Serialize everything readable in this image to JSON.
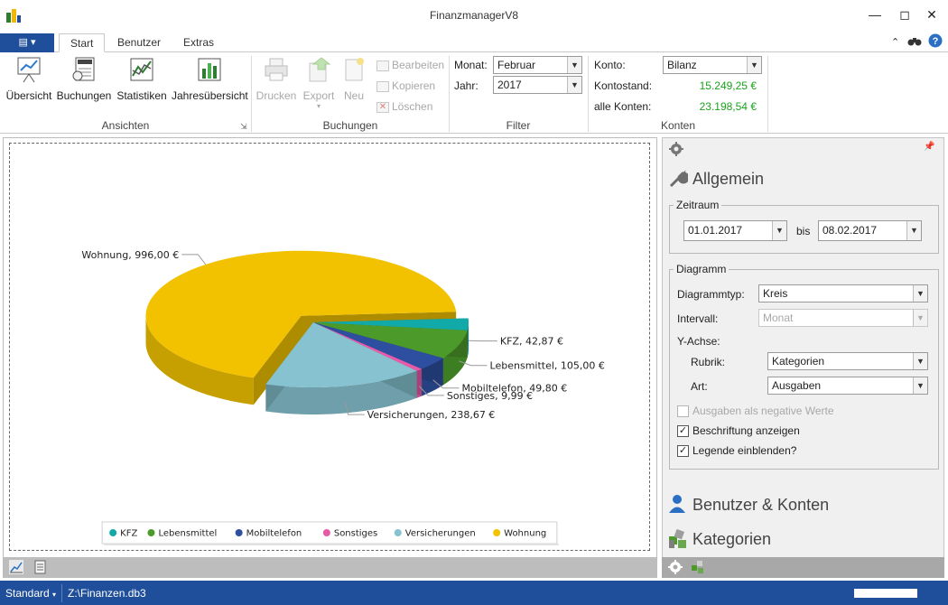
{
  "window": {
    "title": "FinanzmanagerV8"
  },
  "tabs": [
    {
      "label": "Start"
    },
    {
      "label": "Benutzer"
    },
    {
      "label": "Extras"
    }
  ],
  "ribbon": {
    "ansichten": {
      "label": "Ansichten",
      "buttons": [
        {
          "label": "Übersicht",
          "icon": "overview-icon"
        },
        {
          "label": "Buchungen",
          "icon": "invoice-icon"
        },
        {
          "label": "Statistiken",
          "icon": "statistics-icon"
        },
        {
          "label": "Jahresübersicht",
          "icon": "year-overview-icon"
        }
      ]
    },
    "buchungen": {
      "label": "Buchungen",
      "buttons": [
        {
          "label": "Drucken"
        },
        {
          "label": "Export"
        },
        {
          "label": "Neu"
        }
      ],
      "small": [
        {
          "label": "Bearbeiten"
        },
        {
          "label": "Kopieren"
        },
        {
          "label": "Löschen"
        }
      ]
    },
    "filter": {
      "label": "Filter",
      "monat_label": "Monat:",
      "monat_value": "Februar",
      "jahr_label": "Jahr:",
      "jahr_value": "2017"
    },
    "konten": {
      "label": "Konten",
      "konto_label": "Konto:",
      "konto_value": "Bilanz",
      "kontostand_label": "Kontostand:",
      "kontostand_value": "15.249,25 €",
      "alle_label": "alle Konten:",
      "alle_value": "23.198,54 €"
    }
  },
  "chart_data": {
    "type": "pie",
    "style": "3d-exploded",
    "categories": [
      "KFZ",
      "Lebensmittel",
      "Mobiltelefon",
      "Sonstiges",
      "Versicherungen",
      "Wohnung"
    ],
    "values": [
      42.87,
      105.0,
      49.8,
      9.99,
      238.67,
      996.0
    ],
    "colors": [
      "#12aaa8",
      "#4c9a2a",
      "#2e4f9f",
      "#e85aa8",
      "#86c2d0",
      "#f2c200"
    ],
    "data_labels": [
      "KFZ, 42,87 €",
      "Lebensmittel, 105,00 €",
      "Mobiltelefon, 49,80 €",
      "Sonstiges, 9,99 €",
      "Versicherungen, 238,67 €",
      "Wohnung, 996,00 €"
    ],
    "legend": "bottom-center"
  },
  "right_panel": {
    "allgemein": "Allgemein",
    "zeitraum": {
      "title": "Zeitraum",
      "from": "01.01.2017",
      "bis": "bis",
      "to": "08.02.2017"
    },
    "diagramm": {
      "title": "Diagramm",
      "typ_label": "Diagrammtyp:",
      "typ_value": "Kreis",
      "intervall_label": "Intervall:",
      "intervall_value": "Monat",
      "yachse_label": "Y-Achse:",
      "rubrik_label": "Rubrik:",
      "rubrik_value": "Kategorien",
      "art_label": "Art:",
      "art_value": "Ausgaben",
      "chk_negative": "Ausgaben als negative Werte",
      "chk_beschriftung": "Beschriftung anzeigen",
      "chk_legende": "Legende einblenden?"
    },
    "benutzer_konten": "Benutzer & Konten",
    "kategorien": "Kategorien"
  },
  "status": {
    "mode": "Standard",
    "file": "Z:\\Finanzen.db3"
  }
}
